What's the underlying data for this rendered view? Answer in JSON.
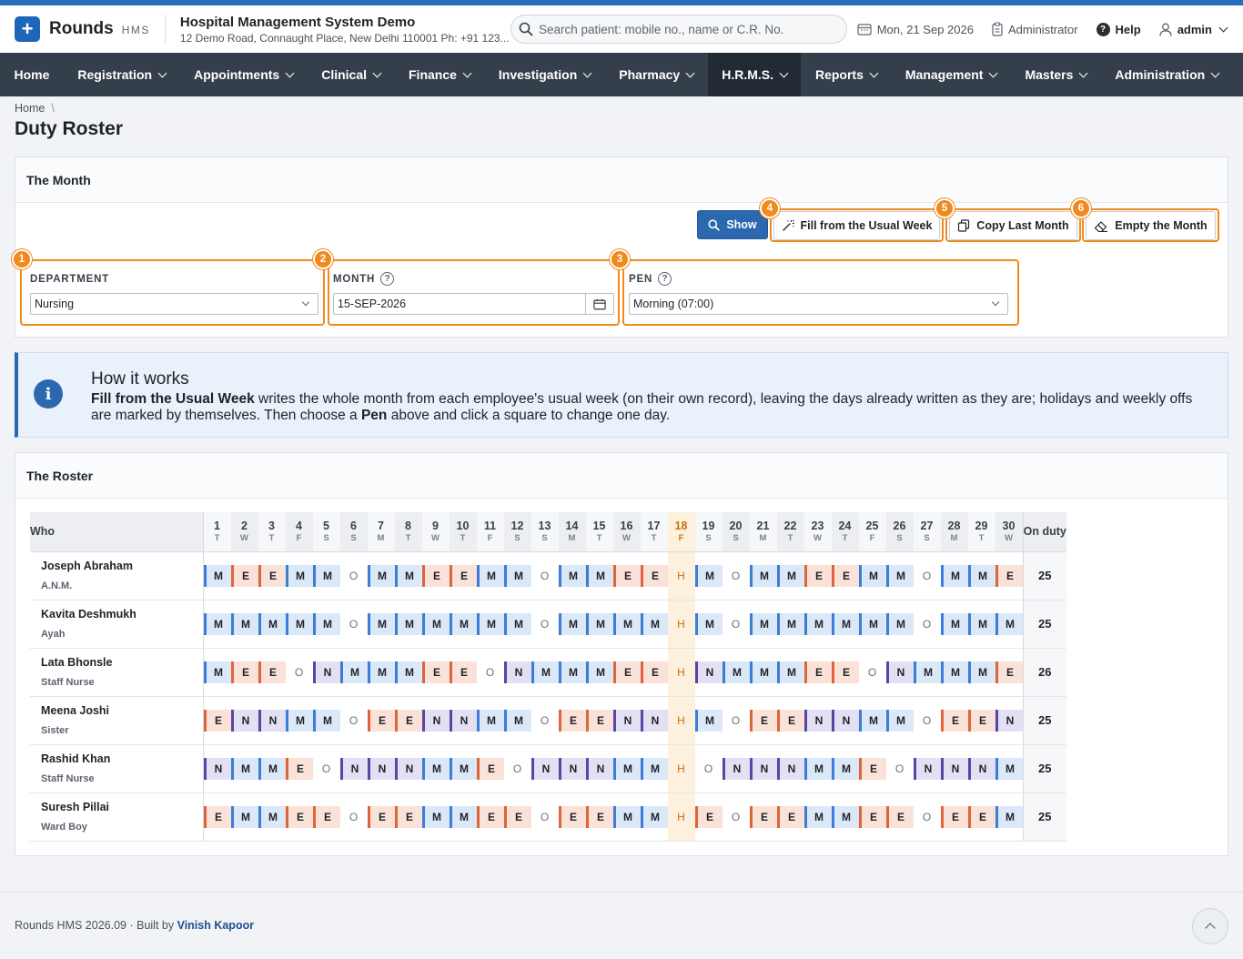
{
  "brand": {
    "name": "Rounds",
    "sub": "HMS"
  },
  "org": {
    "name": "Hospital Management System Demo",
    "address": "12 Demo Road, Connaught Place, New Delhi 110001 Ph: +91 123..."
  },
  "search": {
    "placeholder": "Search patient: mobile no., name or C.R. No."
  },
  "header": {
    "date": "Mon, 21 Sep 2026",
    "role": "Administrator",
    "help": "Help",
    "user": "admin"
  },
  "nav": [
    {
      "label": "Home",
      "dropdown": false,
      "active": false
    },
    {
      "label": "Registration",
      "dropdown": true,
      "active": false
    },
    {
      "label": "Appointments",
      "dropdown": true,
      "active": false
    },
    {
      "label": "Clinical",
      "dropdown": true,
      "active": false
    },
    {
      "label": "Finance",
      "dropdown": true,
      "active": false
    },
    {
      "label": "Investigation",
      "dropdown": true,
      "active": false
    },
    {
      "label": "Pharmacy",
      "dropdown": true,
      "active": false
    },
    {
      "label": "H.R.M.S.",
      "dropdown": true,
      "active": true
    },
    {
      "label": "Reports",
      "dropdown": true,
      "active": false
    },
    {
      "label": "Management",
      "dropdown": true,
      "active": false
    },
    {
      "label": "Masters",
      "dropdown": true,
      "active": false
    },
    {
      "label": "Administration",
      "dropdown": true,
      "active": false
    }
  ],
  "breadcrumb": {
    "home": "Home",
    "sep": "\\"
  },
  "page_title": "Duty Roster",
  "month_card": {
    "title": "The Month",
    "buttons": {
      "show": "Show",
      "fill": "Fill from the Usual Week",
      "copy": "Copy Last Month",
      "empty": "Empty the Month"
    },
    "badges": [
      "1",
      "2",
      "3",
      "4",
      "5",
      "6"
    ],
    "department": {
      "label": "DEPARTMENT",
      "value": "Nursing"
    },
    "month": {
      "label": "MONTH",
      "value": "15-SEP-2026",
      "help": "?"
    },
    "pen": {
      "label": "PEN",
      "value": "Morning (07:00)",
      "help": "?"
    }
  },
  "info": {
    "icon": "i",
    "title": "How it works",
    "p1_bold": "Fill from the Usual Week",
    "p1": " writes the whole month from each employee's usual week (on their own record), leaving the days already written as they are; holidays and weekly offs are marked by themselves. Then choose a ",
    "p2_bold": "Pen",
    "p2": " above and click a square to change one day."
  },
  "roster": {
    "title": "The Roster",
    "who_label": "Who",
    "onduty_label": "On duty",
    "today_day": 18,
    "days": [
      {
        "n": "1",
        "w": "T"
      },
      {
        "n": "2",
        "w": "W"
      },
      {
        "n": "3",
        "w": "T"
      },
      {
        "n": "4",
        "w": "F"
      },
      {
        "n": "5",
        "w": "S"
      },
      {
        "n": "6",
        "w": "S"
      },
      {
        "n": "7",
        "w": "M"
      },
      {
        "n": "8",
        "w": "T"
      },
      {
        "n": "9",
        "w": "W"
      },
      {
        "n": "10",
        "w": "T"
      },
      {
        "n": "11",
        "w": "F"
      },
      {
        "n": "12",
        "w": "S"
      },
      {
        "n": "13",
        "w": "S"
      },
      {
        "n": "14",
        "w": "M"
      },
      {
        "n": "15",
        "w": "T"
      },
      {
        "n": "16",
        "w": "W"
      },
      {
        "n": "17",
        "w": "T"
      },
      {
        "n": "18",
        "w": "F"
      },
      {
        "n": "19",
        "w": "S"
      },
      {
        "n": "20",
        "w": "S"
      },
      {
        "n": "21",
        "w": "M"
      },
      {
        "n": "22",
        "w": "T"
      },
      {
        "n": "23",
        "w": "W"
      },
      {
        "n": "24",
        "w": "T"
      },
      {
        "n": "25",
        "w": "F"
      },
      {
        "n": "26",
        "w": "S"
      },
      {
        "n": "27",
        "w": "S"
      },
      {
        "n": "28",
        "w": "M"
      },
      {
        "n": "29",
        "w": "T"
      },
      {
        "n": "30",
        "w": "W"
      }
    ],
    "employees": [
      {
        "name": "Joseph Abraham",
        "role": "A.N.M.",
        "on_duty": "25",
        "shifts": [
          "M",
          "E",
          "E",
          "M",
          "M",
          "O",
          "M",
          "M",
          "E",
          "E",
          "M",
          "M",
          "O",
          "M",
          "M",
          "E",
          "E",
          "H",
          "M",
          "O",
          "M",
          "M",
          "E",
          "E",
          "M",
          "M",
          "O",
          "M",
          "M",
          "E"
        ]
      },
      {
        "name": "Kavita Deshmukh",
        "role": "Ayah",
        "on_duty": "25",
        "shifts": [
          "M",
          "M",
          "M",
          "M",
          "M",
          "O",
          "M",
          "M",
          "M",
          "M",
          "M",
          "M",
          "O",
          "M",
          "M",
          "M",
          "M",
          "H",
          "M",
          "O",
          "M",
          "M",
          "M",
          "M",
          "M",
          "M",
          "O",
          "M",
          "M",
          "M"
        ]
      },
      {
        "name": "Lata Bhonsle",
        "role": "Staff Nurse",
        "on_duty": "26",
        "shifts": [
          "M",
          "E",
          "E",
          "O",
          "N",
          "M",
          "M",
          "M",
          "E",
          "E",
          "O",
          "N",
          "M",
          "M",
          "M",
          "E",
          "E",
          "H",
          "N",
          "M",
          "M",
          "M",
          "E",
          "E",
          "O",
          "N",
          "M",
          "M",
          "M",
          "E"
        ]
      },
      {
        "name": "Meena Joshi",
        "role": "Sister",
        "on_duty": "25",
        "shifts": [
          "E",
          "N",
          "N",
          "M",
          "M",
          "O",
          "E",
          "E",
          "N",
          "N",
          "M",
          "M",
          "O",
          "E",
          "E",
          "N",
          "N",
          "H",
          "M",
          "O",
          "E",
          "E",
          "N",
          "N",
          "M",
          "M",
          "O",
          "E",
          "E",
          "N"
        ]
      },
      {
        "name": "Rashid Khan",
        "role": "Staff Nurse",
        "on_duty": "25",
        "shifts": [
          "N",
          "M",
          "M",
          "E",
          "O",
          "N",
          "N",
          "N",
          "M",
          "M",
          "E",
          "O",
          "N",
          "N",
          "N",
          "M",
          "M",
          "H",
          "O",
          "N",
          "N",
          "N",
          "M",
          "M",
          "E",
          "O",
          "N",
          "N",
          "N",
          "M"
        ]
      },
      {
        "name": "Suresh Pillai",
        "role": "Ward Boy",
        "on_duty": "25",
        "shifts": [
          "E",
          "M",
          "M",
          "E",
          "E",
          "O",
          "E",
          "E",
          "M",
          "M",
          "E",
          "E",
          "O",
          "E",
          "E",
          "M",
          "M",
          "H",
          "E",
          "O",
          "E",
          "E",
          "M",
          "M",
          "E",
          "E",
          "O",
          "E",
          "E",
          "M"
        ]
      }
    ]
  },
  "footer": {
    "text": "Rounds HMS 2026.09 · Built by ",
    "author": "Vinish Kapoor"
  }
}
